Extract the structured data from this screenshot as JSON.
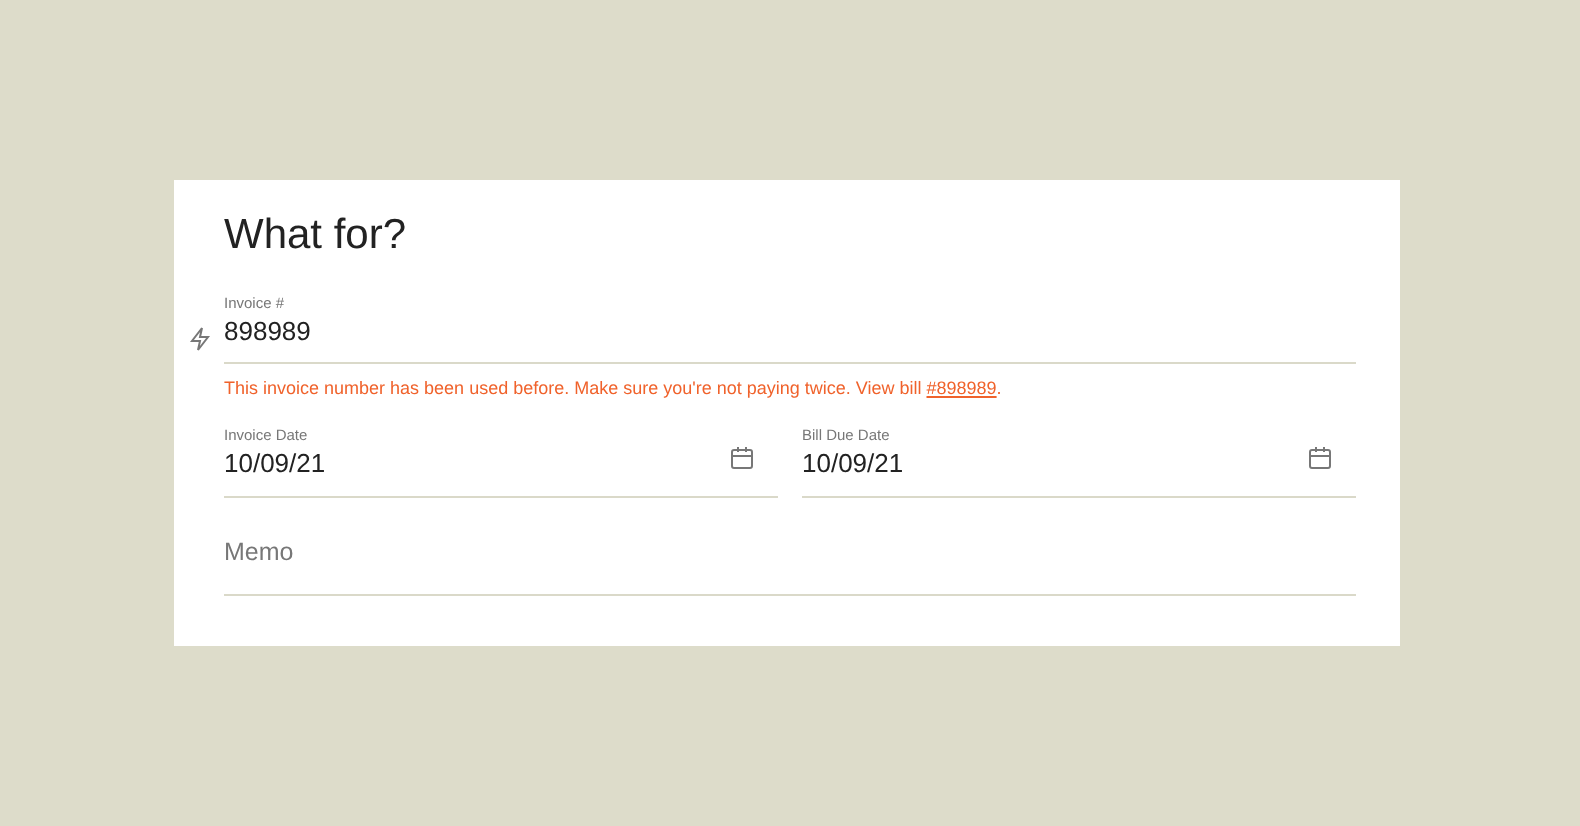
{
  "title": "What for?",
  "invoice": {
    "label": "Invoice #",
    "value": "898989",
    "error": {
      "before": "This invoice number has been used before. Make sure you're not paying twice. View bill ",
      "link": "#898989",
      "after": "."
    }
  },
  "dates": [
    {
      "label": "Invoice Date",
      "value": "10/09/21"
    },
    {
      "label": "Bill Due Date",
      "value": "10/09/21"
    }
  ],
  "memo": {
    "placeholder": "Memo"
  }
}
